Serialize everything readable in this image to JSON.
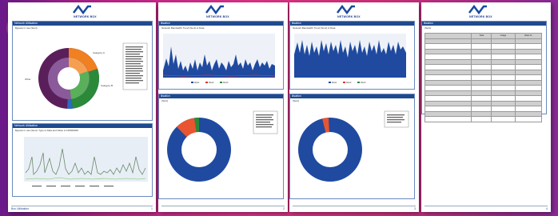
{
  "brand": {
    "logo_text": "NETWORK BOX"
  },
  "pages": [
    {
      "panel1_header": "Network Utilisation",
      "panel1_sub": "Bypass in use (Sent)",
      "panel2_header": "Network Utilisation",
      "panel2_sub": "Bypass in use (Sent): Type is Data and Value is 100000000",
      "footer_left": "Box Utilisation",
      "footer_right": "1"
    },
    {
      "panel1_header": "ilisation",
      "panel1_sub": "Network Bandwidth Trend (Sent) & Data",
      "panel2_header": "ilisation",
      "panel2_sub": "(Sent)",
      "legend": [
        "Row1",
        "Row2",
        "Row3"
      ],
      "footer_right": "2"
    },
    {
      "panel1_header": "ilisation",
      "panel1_sub": "Network Bandwidth Trend (Sent) & Data",
      "panel2_header": "ilisation",
      "panel2_sub": "(Sent)",
      "legend": [
        "Row1",
        "Row2",
        "Row3"
      ],
      "footer_right": "3"
    },
    {
      "panel1_header": "ilisation",
      "panel1_sub": "(Sent)",
      "col_headers": [
        "Total",
        "Usage",
        "Ratio %"
      ],
      "footer_right": "4"
    }
  ]
}
